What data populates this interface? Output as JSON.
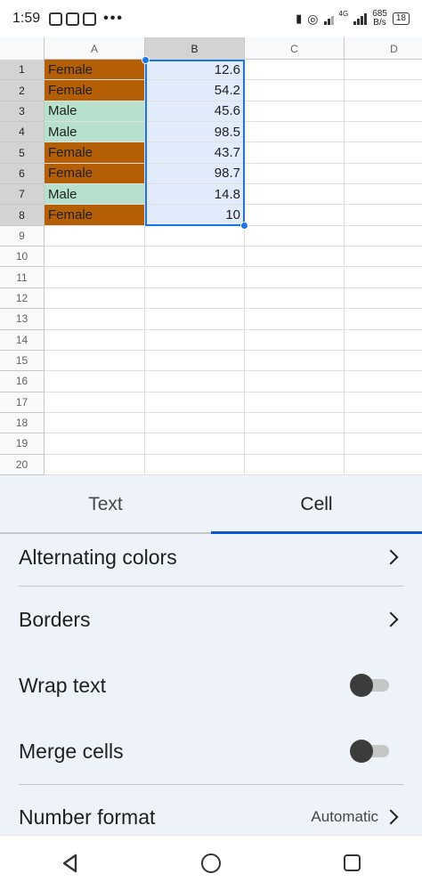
{
  "status_bar": {
    "time": "1:59",
    "network_type": "4G",
    "speed_value": "685",
    "speed_unit": "B/s",
    "battery": "18"
  },
  "sheet": {
    "columns": [
      "A",
      "B",
      "C",
      "D"
    ],
    "selected_column": "B",
    "rows": [
      {
        "n": "1",
        "a": "Female",
        "b": "12.6"
      },
      {
        "n": "2",
        "a": "Female",
        "b": "54.2"
      },
      {
        "n": "3",
        "a": "Male",
        "b": "45.6"
      },
      {
        "n": "4",
        "a": "Male",
        "b": "98.5"
      },
      {
        "n": "5",
        "a": "Female",
        "b": "43.7"
      },
      {
        "n": "6",
        "a": "Female",
        "b": "98.7"
      },
      {
        "n": "7",
        "a": "Male",
        "b": "14.8"
      },
      {
        "n": "8",
        "a": "Female",
        "b": "10"
      },
      {
        "n": "9",
        "a": "",
        "b": ""
      },
      {
        "n": "10",
        "a": "",
        "b": ""
      },
      {
        "n": "11",
        "a": "",
        "b": ""
      },
      {
        "n": "12",
        "a": "",
        "b": ""
      },
      {
        "n": "13",
        "a": "",
        "b": ""
      },
      {
        "n": "14",
        "a": "",
        "b": ""
      },
      {
        "n": "15",
        "a": "",
        "b": ""
      },
      {
        "n": "16",
        "a": "",
        "b": ""
      },
      {
        "n": "17",
        "a": "",
        "b": ""
      },
      {
        "n": "18",
        "a": "",
        "b": ""
      },
      {
        "n": "19",
        "a": "",
        "b": ""
      },
      {
        "n": "20",
        "a": "",
        "b": ""
      }
    ],
    "colors": {
      "female_fill": "#b45f06",
      "male_fill": "#b7e1cd",
      "selection_fill": "#e1ebfc",
      "selection_border": "#1a73e8"
    }
  },
  "panel": {
    "tabs": [
      {
        "label": "Text",
        "active": false
      },
      {
        "label": "Cell",
        "active": true
      }
    ],
    "options": {
      "alternating_colors": "Alternating colors",
      "borders": "Borders",
      "wrap_text": "Wrap text",
      "merge_cells": "Merge cells",
      "number_format": "Number format",
      "number_format_value": "Automatic"
    }
  }
}
